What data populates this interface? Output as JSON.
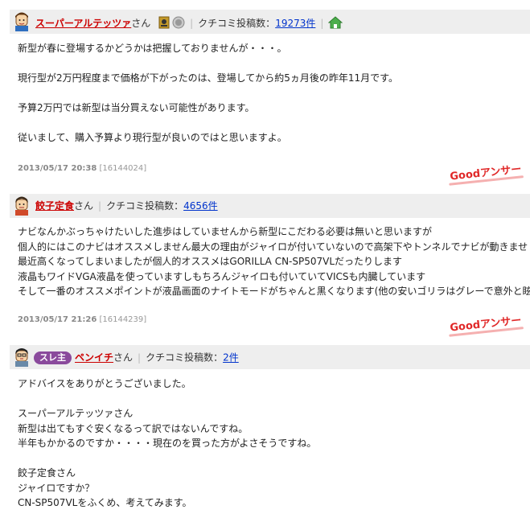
{
  "posts": [
    {
      "username": "スーパーアルテッツァ",
      "san": "さん",
      "kuchikomi_label": "クチコミ投稿数：",
      "kuchikomi_count": "19273件",
      "lines": [
        "新型が春に登場するかどうかは把握しておりませんが・・・。",
        "",
        "現行型が2万円程度まで価格が下がったのは、登場してから約5ヵ月後の昨年11月です。",
        "",
        "予算2万円では新型は当分買えない可能性があります。",
        "",
        "従いまして、購入予算より現行型が良いのではと思いますよ。"
      ],
      "timestamp": "2013/05/17 20:38",
      "post_id": "[16144024]",
      "good_answer": "Goodアンサー"
    },
    {
      "username": "餃子定食",
      "san": "さん",
      "kuchikomi_label": "クチコミ投稿数：",
      "kuchikomi_count": "4656件",
      "lines": [
        "ナビなんかぶっちゃけたいした進歩はしていませんから新型にこだわる必要は無いと思いますが",
        "個人的にはこのナビはオススメしません最大の理由がジャイロが付いていないので高架下やトンネルでナビが動きませ",
        "最近高くなってしまいましたが個人的オススメはGORILLA CN-SP507VLだったりします",
        "液晶もワイドVGA液晶を使っていますしもちろんジャイロも付いていてVICSも内臓しています",
        "そして一番のオススメポイントが液晶画面のナイトモードがちゃんと黒くなります(他の安いゴリラはグレーで意外と眩し"
      ],
      "timestamp": "2013/05/17 21:26",
      "post_id": "[16144239]",
      "good_answer": "Goodアンサー"
    },
    {
      "sure_label": "スレ主",
      "username": "ペンイチ",
      "san": "さん",
      "kuchikomi_label": "クチコミ投稿数：",
      "kuchikomi_count": "2件",
      "lines": [
        "アドバイスをありがとうございました。",
        "",
        "スーパーアルテッツァさん",
        "新型は出てもすぐ安くなるって訳ではないんですね。",
        "半年もかかるのですか・・・・現在のを買った方がよさそうですね。",
        "",
        "餃子定食さん",
        "ジャイロですか？",
        "CN-SP507VLをふくめ、考えてみます。"
      ]
    }
  ]
}
